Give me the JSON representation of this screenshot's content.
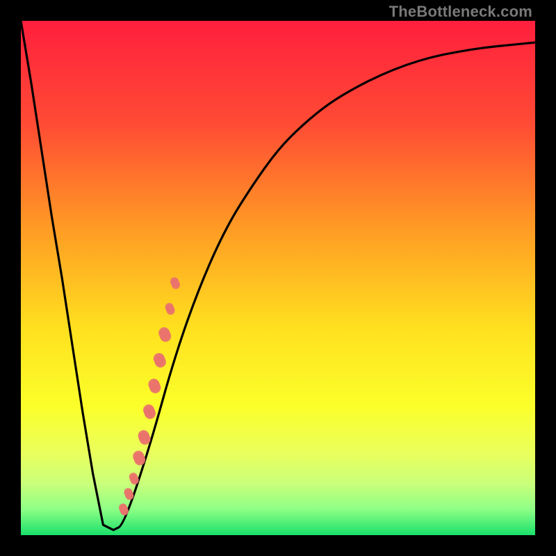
{
  "branding": {
    "text": "TheBottleneck.com"
  },
  "chart_data": {
    "type": "line",
    "title": "",
    "xlabel": "",
    "ylabel": "",
    "xlim": [
      0,
      100
    ],
    "ylim": [
      0,
      100
    ],
    "series": [
      {
        "name": "bottleneck-curve",
        "x": [
          0,
          2,
          4,
          6,
          8,
          10,
          12,
          14,
          16,
          18,
          20,
          25,
          30,
          35,
          40,
          45,
          50,
          55,
          60,
          65,
          70,
          75,
          80,
          85,
          90,
          95,
          100
        ],
        "y": [
          100,
          88,
          75,
          62,
          50,
          37,
          24,
          12,
          2,
          1,
          2,
          17,
          35,
          49,
          60,
          68,
          75,
          80,
          84,
          87,
          89.5,
          91.5,
          93,
          94,
          94.8,
          95.3,
          95.8
        ]
      }
    ],
    "highlight_segment": {
      "note": "salmon dotted cluster on rising branch",
      "x": [
        20,
        21,
        22,
        23,
        24,
        25,
        26,
        27,
        28,
        29,
        30
      ],
      "y": [
        5,
        8,
        11,
        15,
        19,
        24,
        29,
        34,
        39,
        44,
        49
      ]
    },
    "gradient_stops": [
      {
        "pct": 0,
        "color": "#ff1f3d"
      },
      {
        "pct": 20,
        "color": "#ff4b34"
      },
      {
        "pct": 40,
        "color": "#ff9a24"
      },
      {
        "pct": 60,
        "color": "#ffe11f"
      },
      {
        "pct": 75,
        "color": "#fbff2a"
      },
      {
        "pct": 84,
        "color": "#eaff5c"
      },
      {
        "pct": 90,
        "color": "#c9ff7a"
      },
      {
        "pct": 95,
        "color": "#8dff86"
      },
      {
        "pct": 100,
        "color": "#19e06a"
      }
    ]
  }
}
